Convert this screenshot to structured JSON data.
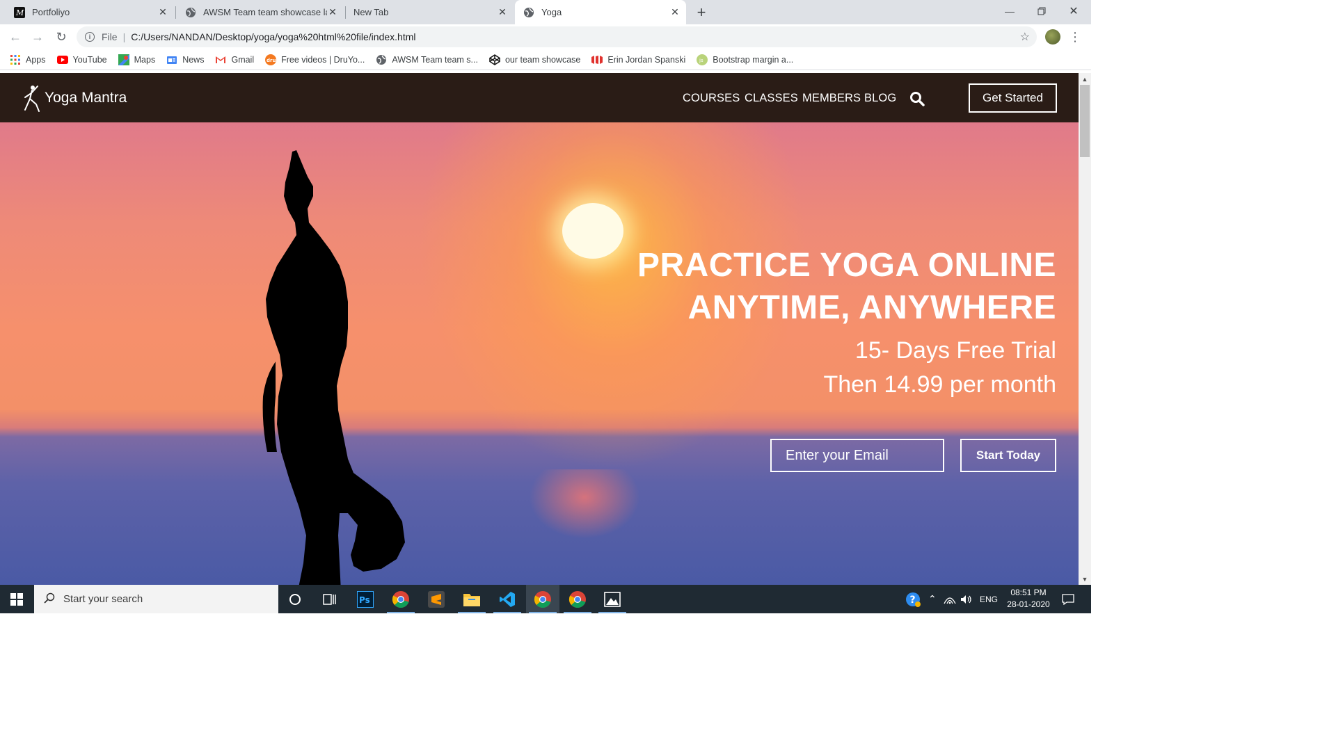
{
  "browser": {
    "tabs": [
      {
        "title": "Portfoliyo",
        "active": false
      },
      {
        "title": "AWSM Team team showcase layout",
        "active": false
      },
      {
        "title": "New Tab",
        "active": false
      },
      {
        "title": "Yoga",
        "active": true
      }
    ],
    "url_scheme": "File",
    "url": "C:/Users/NANDAN/Desktop/yoga/yoga%20html%20file/index.html",
    "bookmarks": [
      {
        "label": "Apps",
        "icon": "apps-grid-icon"
      },
      {
        "label": "YouTube",
        "icon": "youtube-icon"
      },
      {
        "label": "Maps",
        "icon": "maps-icon"
      },
      {
        "label": "News",
        "icon": "news-icon"
      },
      {
        "label": "Gmail",
        "icon": "gmail-icon"
      },
      {
        "label": "Free videos | DruYo...",
        "icon": "druyo-icon"
      },
      {
        "label": "AWSM Team team s...",
        "icon": "globe-icon"
      },
      {
        "label": "our team showcase",
        "icon": "codepen-icon"
      },
      {
        "label": "Erin Jordan Spanski",
        "icon": "erin-icon"
      },
      {
        "label": "Bootstrap margin a...",
        "icon": "bootstrap-icon"
      }
    ]
  },
  "site": {
    "brand": "Yoga Mantra",
    "nav": [
      "COURSES",
      "CLASSES",
      "MEMBERS",
      "BLOG"
    ],
    "cta": "Get Started",
    "hero": {
      "headline_1": "PRACTICE YOGA ONLINE",
      "headline_2": "ANYTIME, ANYWHERE",
      "sub_1": "15- Days Free Trial",
      "sub_2": "Then 14.99 per month",
      "email_placeholder": "Enter your Email",
      "button": "Start Today"
    }
  },
  "taskbar": {
    "search_placeholder": "Start your search",
    "language": "ENG",
    "time": "08:51 PM",
    "date": "28-01-2020"
  },
  "colors": {
    "navbar": "#2a1c16",
    "tab_strip": "#dee1e6",
    "taskbar": "#1f2a33"
  }
}
